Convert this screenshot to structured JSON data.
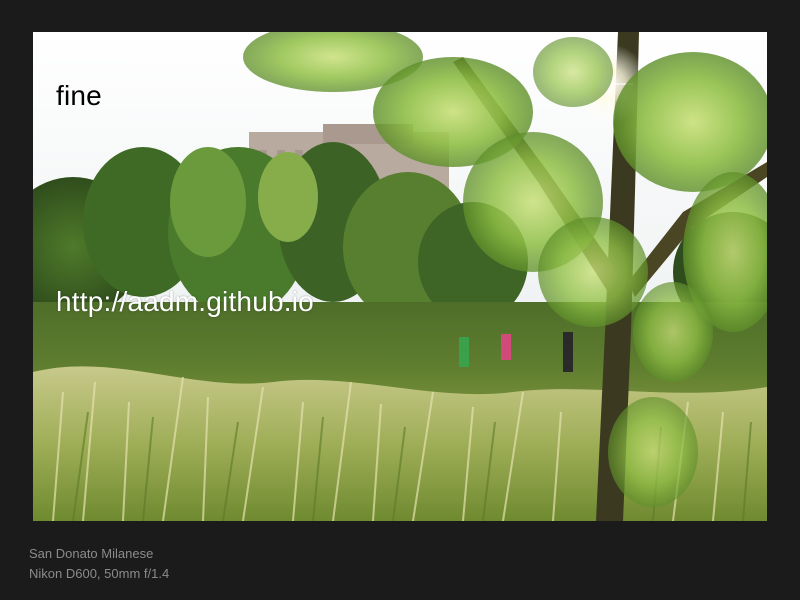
{
  "slide": {
    "title": "fine",
    "link": "http://aadm.github.io"
  },
  "caption": {
    "location": "San Donato Milanese",
    "camera": "Nikon D600, 50mm f/1.4"
  },
  "colors": {
    "background": "#1b1b1b",
    "caption_text": "#8b8b8b",
    "title_text": "#000000",
    "link_text": "#ffffff"
  }
}
